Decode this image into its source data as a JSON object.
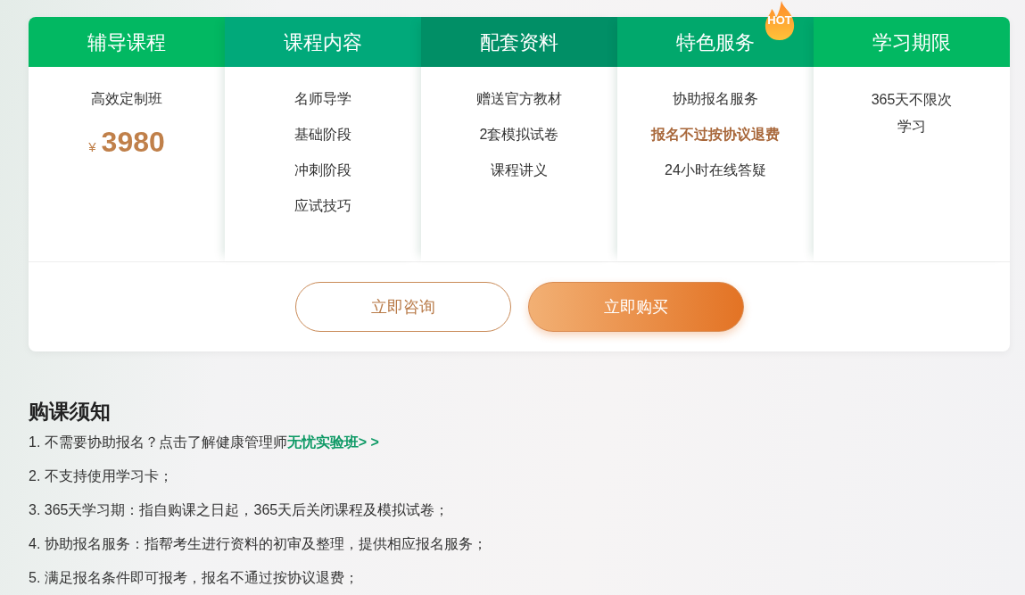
{
  "columns": [
    {
      "title": "辅导课程",
      "color": "#02b862",
      "items": [
        {
          "kind": "text",
          "text": "高效定制班"
        },
        {
          "kind": "price",
          "currency": "¥",
          "amount": "3980"
        }
      ]
    },
    {
      "title": "课程内容",
      "color": "#01a97a",
      "items": [
        {
          "kind": "text",
          "text": "名师导学"
        },
        {
          "kind": "text",
          "text": "基础阶段"
        },
        {
          "kind": "text",
          "text": "冲刺阶段"
        },
        {
          "kind": "text",
          "text": "应试技巧"
        }
      ]
    },
    {
      "title": "配套资料",
      "color": "#018f66",
      "items": [
        {
          "kind": "text",
          "text": "赠送官方教材"
        },
        {
          "kind": "text",
          "text": "2套模拟试卷"
        },
        {
          "kind": "text",
          "text": "课程讲义"
        }
      ]
    },
    {
      "title": "特色服务",
      "color": "#01a86c",
      "hot_badge": "HOT",
      "items": [
        {
          "kind": "text",
          "text": "协助报名服务"
        },
        {
          "kind": "highlight",
          "text": "报名不过按协议退费"
        },
        {
          "kind": "text",
          "text": "24小时在线答疑"
        }
      ]
    },
    {
      "title": "学习期限",
      "color": "#02b862",
      "items": [
        {
          "kind": "wrap",
          "text": "365天不限次学习"
        }
      ]
    }
  ],
  "buttons": [
    {
      "kind": "outline",
      "label": "立即咨询"
    },
    {
      "kind": "filled",
      "label": "立即购买"
    }
  ],
  "notice": {
    "title": "购课须知",
    "items": [
      {
        "text": "1. 不需要协助报名？点击了解健康管理师",
        "link": "无忧实验班> >"
      },
      {
        "text": "2. 不支持使用学习卡；"
      },
      {
        "text": "3. 365天学习期：指自购课之日起，365天后关闭课程及模拟试卷；"
      },
      {
        "text": "4. 协助报名服务：指帮考生进行资料的初审及整理，提供相应报名服务；"
      },
      {
        "text": "5. 满足报名条件即可报考，报名不通过按协议退费；"
      }
    ]
  }
}
